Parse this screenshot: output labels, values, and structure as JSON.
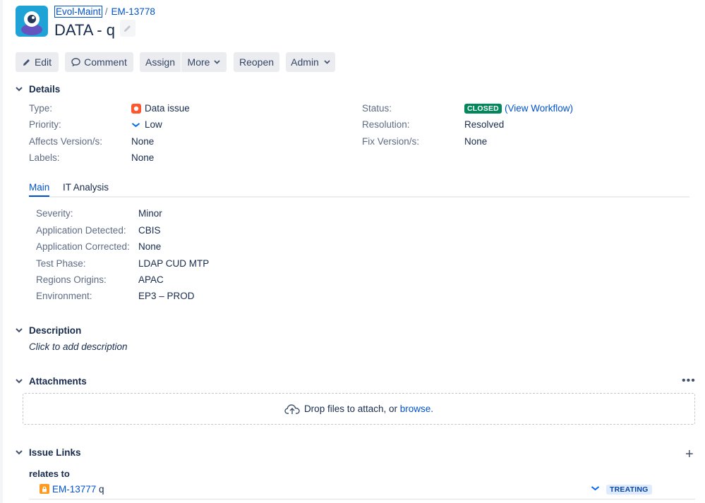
{
  "breadcrumb": {
    "project": "Evol-Maint",
    "separator": "/",
    "issue_key": "EM-13778"
  },
  "issue_title": "DATA - q",
  "toolbar": {
    "edit": "Edit",
    "comment": "Comment",
    "assign": "Assign",
    "more": "More",
    "reopen": "Reopen",
    "admin": "Admin"
  },
  "details": {
    "heading": "Details",
    "type_label": "Type:",
    "type_value": "Data issue",
    "priority_label": "Priority:",
    "priority_value": "Low",
    "affects_label": "Affects Version/s:",
    "affects_value": "None",
    "labels_label": "Labels:",
    "labels_value": "None",
    "status_label": "Status:",
    "status_value": "CLOSED",
    "workflow_link": "(View Workflow)",
    "resolution_label": "Resolution:",
    "resolution_value": "Resolved",
    "fix_label": "Fix Version/s:",
    "fix_value": "None"
  },
  "tabs": {
    "main": "Main",
    "it_analysis": "IT Analysis"
  },
  "custom_fields": [
    {
      "label": "Severity:",
      "value": "Minor"
    },
    {
      "label": "Application Detected:",
      "value": "CBIS"
    },
    {
      "label": "Application Corrected:",
      "value": "None"
    },
    {
      "label": "Test Phase:",
      "value": "LDAP CUD MTP"
    },
    {
      "label": "Regions Origins:",
      "value": "APAC"
    },
    {
      "label": "Environment:",
      "value": "EP3 – PROD"
    }
  ],
  "description": {
    "heading": "Description",
    "placeholder": "Click to add description"
  },
  "attachments": {
    "heading": "Attachments",
    "more": "•••",
    "drop_text": "Drop files to attach, or",
    "browse": "browse."
  },
  "issue_links": {
    "heading": "Issue Links",
    "add": "+",
    "relation": "relates to",
    "items": [
      {
        "key": "EM-13777",
        "summary": "q",
        "status": "TREATING"
      }
    ]
  },
  "colors": {
    "link": "#0052cc",
    "closed": "#00875a",
    "data_issue": "#ff5630",
    "treating_bg": "#deebff",
    "treating_text": "#0747a6"
  }
}
